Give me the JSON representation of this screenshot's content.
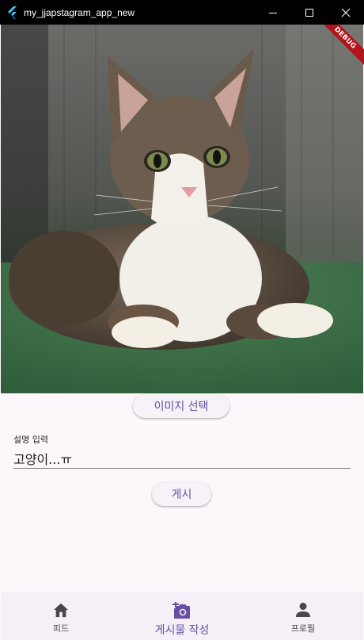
{
  "window": {
    "title": "my_jjapstagram_app_new"
  },
  "debug_banner": "DEBUG",
  "image_select_label": "이미지 선택",
  "description_field": {
    "label": "설명 입력",
    "value": "고양이...ㅠ"
  },
  "post_label": "게시",
  "bottom_nav": {
    "items": [
      {
        "label": "피드",
        "icon": "home-icon",
        "active": false
      },
      {
        "label": "게시물 작성",
        "icon": "add-photo-icon",
        "active": true
      },
      {
        "label": "프로필",
        "icon": "person-icon",
        "active": false
      }
    ]
  },
  "colors": {
    "primary": "#6750a4",
    "background": "#fdf7fc",
    "debug": "#b0151c"
  }
}
